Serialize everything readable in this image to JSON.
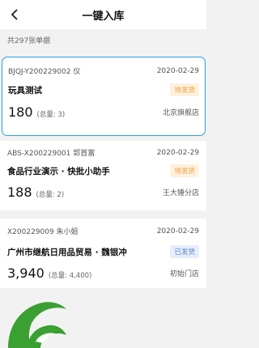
{
  "header": {
    "title": "一键入库",
    "back_icon": "chevron-left-icon"
  },
  "summary": "共297张单据",
  "orders": [
    {
      "code": "BJQJ-Y200229002  仪",
      "date": "2020-02-29",
      "name": "玩具测试",
      "status": "待发货",
      "status_type": "pending",
      "amount": "180",
      "qty": "(总量: 3)",
      "store": "北京旗舰店",
      "selected": true
    },
    {
      "code": "ABS-X200229001  郭首富",
      "date": "2020-02-29",
      "name": "食品行业演示 · 快批小助手",
      "status": "待发货",
      "status_type": "pending",
      "amount": "188",
      "qty": "(总量: 2)",
      "store": "王大锤分店",
      "selected": false
    },
    {
      "code": "X200229009  朱小姐",
      "date": "2020-02-29",
      "name": "广州市继航日用品贸易 · 魏银冲",
      "status": "已发货",
      "status_type": "shipped",
      "amount": "3,940",
      "qty": "(总量: 4,400)",
      "store": "初始门店",
      "selected": false
    }
  ],
  "colors": {
    "accent": "#2aa0e0",
    "pending": "#f0a040",
    "shipped": "#5a7fc8",
    "logo_green": "#3aa032"
  }
}
